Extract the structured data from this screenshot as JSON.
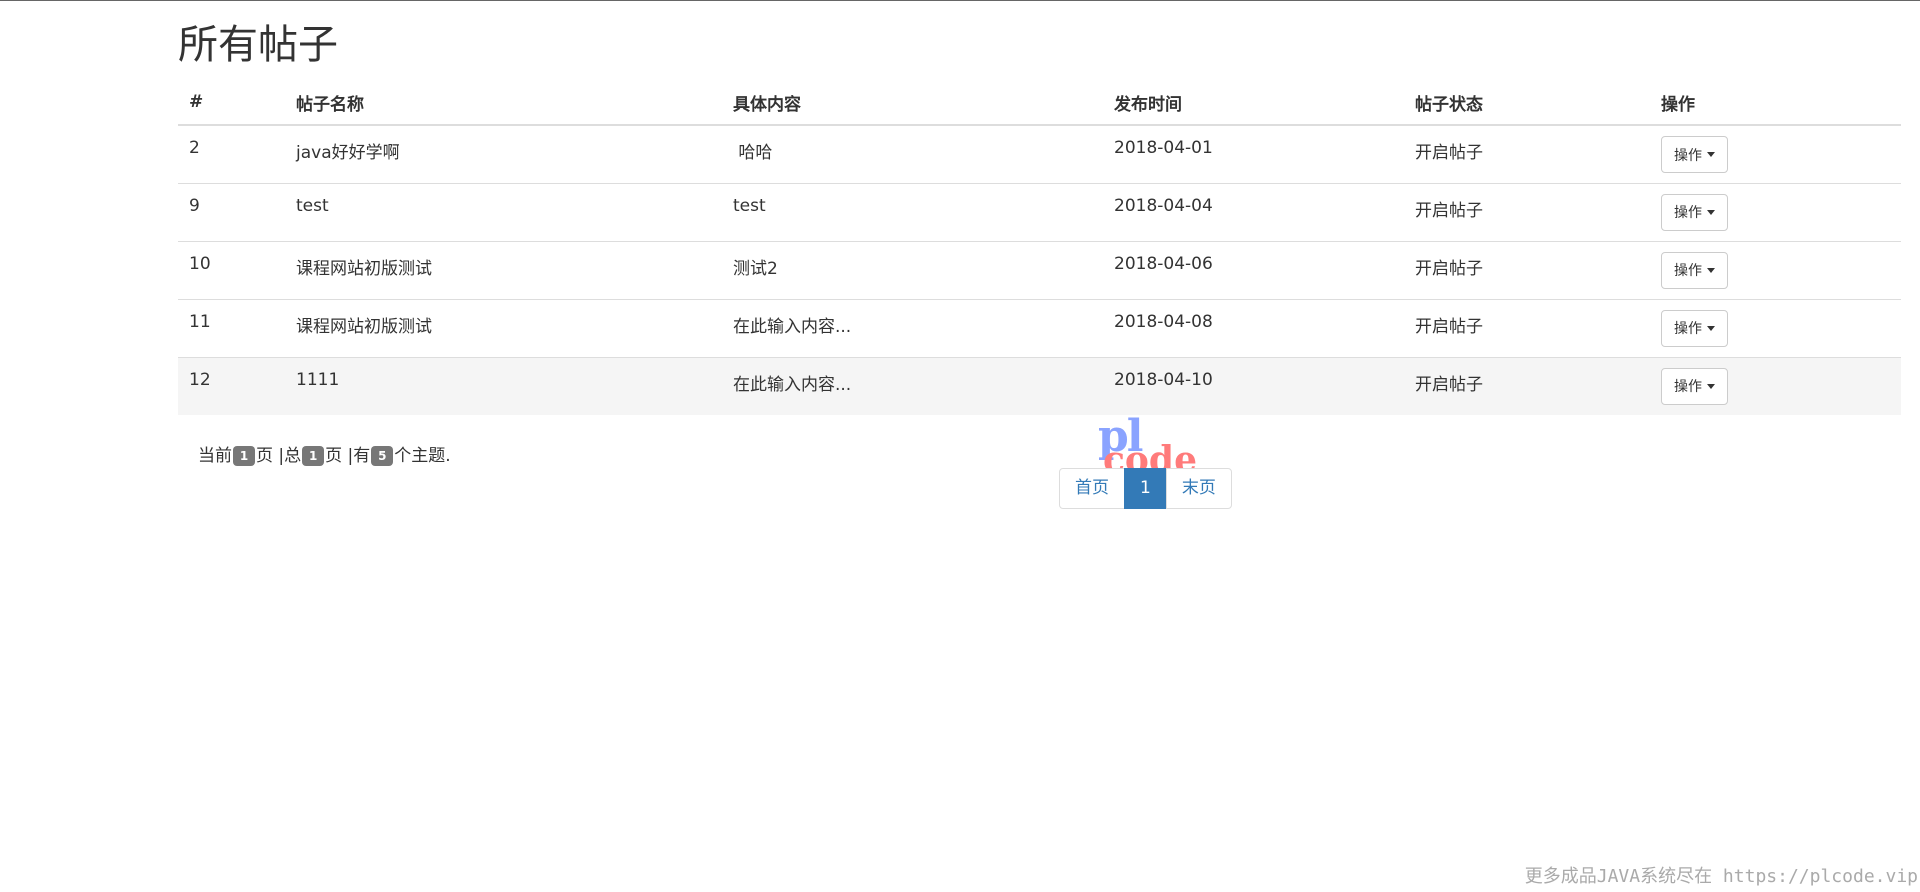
{
  "page": {
    "title": "所有帖子"
  },
  "table": {
    "headers": [
      "#",
      "帖子名称",
      "具体内容",
      "发布时间",
      "帖子状态",
      "操作"
    ],
    "rows": [
      {
        "id": "2",
        "name": "java好好学啊",
        "content": " 哈哈",
        "date": "2018-04-01",
        "status": "开启帖子",
        "action": "操作"
      },
      {
        "id": "9",
        "name": "test",
        "content": "test",
        "date": "2018-04-04",
        "status": "开启帖子",
        "action": "操作"
      },
      {
        "id": "10",
        "name": "课程网站初版测试",
        "content": "测试2",
        "date": "2018-04-06",
        "status": "开启帖子",
        "action": "操作"
      },
      {
        "id": "11",
        "name": "课程网站初版测试",
        "content": "在此输入内容...",
        "date": "2018-04-08",
        "status": "开启帖子",
        "action": "操作"
      },
      {
        "id": "12",
        "name": "1111",
        "content": "在此输入内容...",
        "date": "2018-04-10",
        "status": "开启帖子",
        "action": "操作"
      }
    ]
  },
  "page_info": {
    "t1": "当前",
    "current": "1",
    "t2": "页 |总",
    "total": "1",
    "t3": "页 |有",
    "count": "5",
    "t4": "个主题."
  },
  "pagination": {
    "first": "首页",
    "current": "1",
    "last": "末页",
    "active_color": "#337ab7"
  },
  "logo": {
    "line1": "pl",
    "line2": "code"
  },
  "footer": {
    "text": "更多成品JAVA系统尽在 https://plcode.vip"
  }
}
